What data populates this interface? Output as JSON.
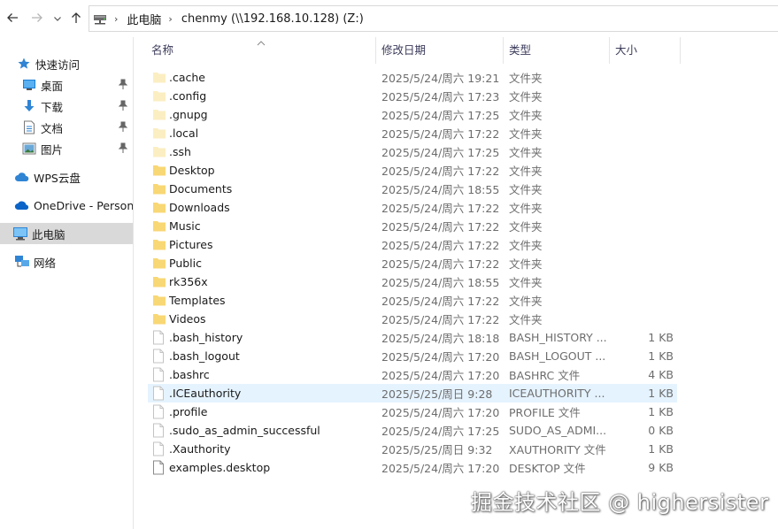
{
  "address": {
    "segments": [
      "此电脑",
      "chenmy (\\\\192.168.10.128) (Z:)"
    ]
  },
  "icons": {
    "back": "arrow-left-icon",
    "forward": "arrow-right-icon",
    "recent": "chevron-down-icon",
    "up": "arrow-up-icon"
  },
  "sidebar": {
    "items": [
      {
        "label": "快速访问",
        "icon": "star-icon"
      },
      {
        "label": "桌面",
        "icon": "desktop-icon",
        "pinned": true
      },
      {
        "label": "下载",
        "icon": "download-icon",
        "pinned": true
      },
      {
        "label": "文档",
        "icon": "document-icon",
        "pinned": true
      },
      {
        "label": "图片",
        "icon": "picture-icon",
        "pinned": true
      },
      {
        "label": "WPS云盘",
        "icon": "cloud-icon"
      },
      {
        "label": "OneDrive - Persona",
        "icon": "onedrive-icon"
      },
      {
        "label": "此电脑",
        "icon": "computer-icon",
        "selected": true
      },
      {
        "label": "网络",
        "icon": "network-icon"
      }
    ]
  },
  "columns": {
    "name": "名称",
    "date": "修改日期",
    "type": "类型",
    "size": "大小"
  },
  "files": [
    {
      "name": ".cache",
      "date": "2025/5/24/周六 19:21",
      "type": "文件夹",
      "size": "",
      "kind": "folder-faded"
    },
    {
      "name": ".config",
      "date": "2025/5/24/周六 17:23",
      "type": "文件夹",
      "size": "",
      "kind": "folder-faded"
    },
    {
      "name": ".gnupg",
      "date": "2025/5/24/周六 17:25",
      "type": "文件夹",
      "size": "",
      "kind": "folder-faded"
    },
    {
      "name": ".local",
      "date": "2025/5/24/周六 17:22",
      "type": "文件夹",
      "size": "",
      "kind": "folder-faded"
    },
    {
      "name": ".ssh",
      "date": "2025/5/24/周六 17:25",
      "type": "文件夹",
      "size": "",
      "kind": "folder-faded"
    },
    {
      "name": "Desktop",
      "date": "2025/5/24/周六 17:22",
      "type": "文件夹",
      "size": "",
      "kind": "folder"
    },
    {
      "name": "Documents",
      "date": "2025/5/24/周六 18:55",
      "type": "文件夹",
      "size": "",
      "kind": "folder"
    },
    {
      "name": "Downloads",
      "date": "2025/5/24/周六 17:22",
      "type": "文件夹",
      "size": "",
      "kind": "folder"
    },
    {
      "name": "Music",
      "date": "2025/5/24/周六 17:22",
      "type": "文件夹",
      "size": "",
      "kind": "folder"
    },
    {
      "name": "Pictures",
      "date": "2025/5/24/周六 17:22",
      "type": "文件夹",
      "size": "",
      "kind": "folder"
    },
    {
      "name": "Public",
      "date": "2025/5/24/周六 17:22",
      "type": "文件夹",
      "size": "",
      "kind": "folder"
    },
    {
      "name": "rk356x",
      "date": "2025/5/24/周六 18:55",
      "type": "文件夹",
      "size": "",
      "kind": "folder"
    },
    {
      "name": "Templates",
      "date": "2025/5/24/周六 17:22",
      "type": "文件夹",
      "size": "",
      "kind": "folder"
    },
    {
      "name": "Videos",
      "date": "2025/5/24/周六 17:22",
      "type": "文件夹",
      "size": "",
      "kind": "folder"
    },
    {
      "name": ".bash_history",
      "date": "2025/5/24/周六 18:18",
      "type": "BASH_HISTORY ...",
      "size": "1 KB",
      "kind": "file-faded"
    },
    {
      "name": ".bash_logout",
      "date": "2025/5/24/周六 17:20",
      "type": "BASH_LOGOUT ...",
      "size": "1 KB",
      "kind": "file-faded"
    },
    {
      "name": ".bashrc",
      "date": "2025/5/24/周六 17:20",
      "type": "BASHRC 文件",
      "size": "4 KB",
      "kind": "file-faded"
    },
    {
      "name": ".ICEauthority",
      "date": "2025/5/25/周日 9:28",
      "type": "ICEAUTHORITY ...",
      "size": "1 KB",
      "kind": "file-faded",
      "hover": true
    },
    {
      "name": ".profile",
      "date": "2025/5/24/周六 17:20",
      "type": "PROFILE 文件",
      "size": "1 KB",
      "kind": "file-faded"
    },
    {
      "name": ".sudo_as_admin_successful",
      "date": "2025/5/24/周六 17:25",
      "type": "SUDO_AS_ADMI...",
      "size": "0 KB",
      "kind": "file-faded"
    },
    {
      "name": ".Xauthority",
      "date": "2025/5/25/周日 9:32",
      "type": "XAUTHORITY 文件",
      "size": "1 KB",
      "kind": "file-faded"
    },
    {
      "name": "examples.desktop",
      "date": "2025/5/24/周六 17:20",
      "type": "DESKTOP 文件",
      "size": "9 KB",
      "kind": "file"
    }
  ],
  "watermark": "掘金技术社区 @ highersister",
  "colors": {
    "folder": "#f8d775",
    "folder_faded": "#fbeec2",
    "selected_bg": "#d9d9d9",
    "hover_bg": "#e5f3ff",
    "accent": "#0078d7"
  }
}
